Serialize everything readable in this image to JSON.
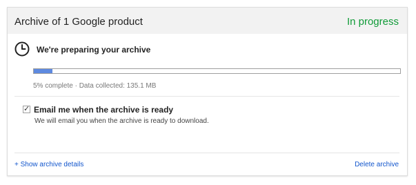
{
  "archive": {
    "title": "Archive of 1 Google product",
    "status": "In progress",
    "status_color": "#109b38",
    "progress": {
      "icon": "clock-icon",
      "heading": "We're preparing your archive",
      "percent": 5,
      "meta": "5% complete · Data collected: 135.1 MB",
      "bar_color": "#5e8ae0"
    },
    "email": {
      "checked": true,
      "label": "Email me when the archive is ready",
      "description": "We will email you when the archive is ready to download."
    },
    "footer": {
      "show_details": "+ Show archive details",
      "delete": "Delete archive",
      "link_color": "#1155cc"
    }
  }
}
